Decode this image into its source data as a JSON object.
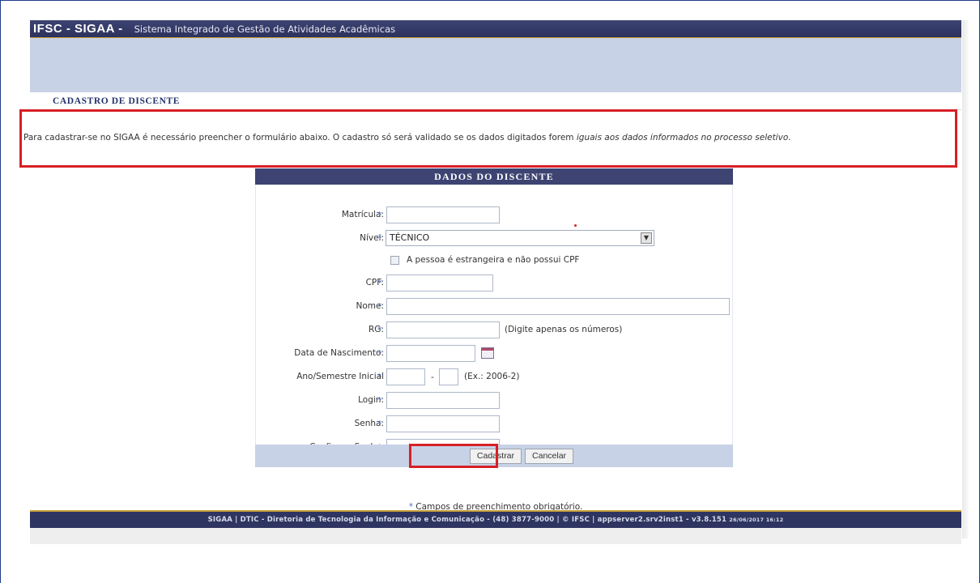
{
  "header": {
    "brand": "IFSC - SIGAA -",
    "system_name": "Sistema Integrado de Gestão de Atividades Acadêmicas"
  },
  "section": {
    "title": "CADASTRO DE DISCENTE"
  },
  "info": {
    "text_plain": "Para cadastrar-se no SIGAA é necessário preencher o formulário abaixo. O cadastro só será validado se os dados digitados forem ",
    "text_italic": "iguais aos dados informados no processo seletivo",
    "text_end": "."
  },
  "form": {
    "title": "DADOS DO DISCENTE",
    "required_marker": "*",
    "matricula": {
      "label": "Matrícula:",
      "value": ""
    },
    "nivel": {
      "label": "Nível:",
      "value": "TÉCNICO"
    },
    "estrangeiro": {
      "label": "A pessoa é estrangeira e não possui CPF",
      "checked": false
    },
    "cpf": {
      "label": "CPF:",
      "value": ""
    },
    "nome": {
      "label": "Nome:",
      "value": ""
    },
    "rg": {
      "label": "RG:",
      "value": "",
      "hint": "(Digite apenas os números)"
    },
    "nascimento": {
      "label": "Data de Nascimento:",
      "value": ""
    },
    "ano_semestre": {
      "label": "Ano/Semestre Inicial",
      "ano": "",
      "semestre": "",
      "separator": "-",
      "hint": "(Ex.: 2006-2)"
    },
    "login": {
      "label": "Login:",
      "value": ""
    },
    "senha": {
      "label": "Senha:",
      "value": ""
    },
    "confirmar_senha": {
      "label": "Confirmar Senha:",
      "value": ""
    }
  },
  "buttons": {
    "submit": "Cadastrar",
    "cancel": "Cancelar"
  },
  "required_note": {
    "star": "*",
    "text": "Campos de preenchimento obrigatório."
  },
  "footer": {
    "text": "SIGAA | DTIC - Diretoria de Tecnologia da Informação e Comunicação - (48) 3877-9000 | © IFSC | appserver2.srv2inst1 - v3.8.151",
    "stamp": "26/06/2017 16:12"
  },
  "colors": {
    "header_bg": "#3d4472",
    "banner_bg": "#c8d2e6",
    "highlight": "#d81f26",
    "title_text": "#22336b"
  },
  "icons": {
    "calendar": "calendar-icon",
    "dropdown": "chevron-down-icon"
  }
}
